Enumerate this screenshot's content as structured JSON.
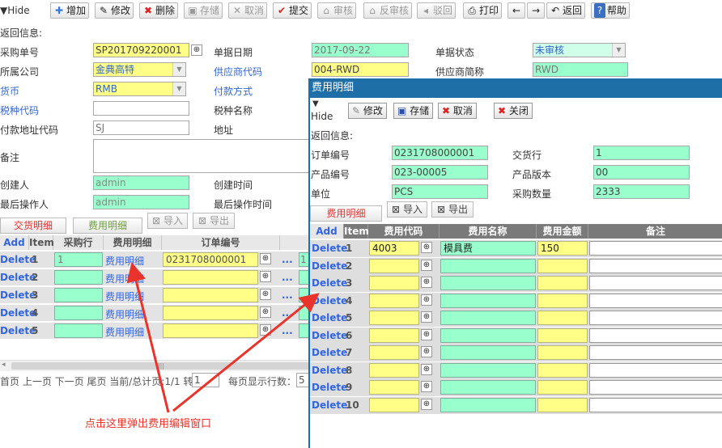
{
  "toolbar": {
    "hide": "Hide",
    "buttons": [
      {
        "label": "增加",
        "icon": "✚"
      },
      {
        "label": "修改",
        "icon": "✎"
      },
      {
        "label": "删除",
        "icon": "✖"
      },
      {
        "label": "存储",
        "icon": "▣"
      },
      {
        "label": "取消",
        "icon": "✕"
      },
      {
        "label": "提交",
        "icon": "✔"
      },
      {
        "label": "审核",
        "icon": "⌂"
      },
      {
        "label": "反审核",
        "icon": "⌂"
      },
      {
        "label": "驳回",
        "icon": "◂"
      },
      {
        "label": "打印",
        "icon": "⎙"
      },
      {
        "label": "返回",
        "icon": "↶"
      },
      {
        "label": "帮助",
        "icon": "?"
      }
    ],
    "prev": "←",
    "next": "→"
  },
  "form": {
    "return_info": "返回信息:",
    "purchase_no_label": "采购单号",
    "purchase_no": "SP201709220001",
    "doc_date_label": "单据日期",
    "doc_date": "2017-09-22",
    "doc_status_label": "单据状态",
    "doc_status": "未审核",
    "company_label": "所属公司",
    "company": "金典高特",
    "supplier_code_label": "供应商代码",
    "supplier_code": "004-RWD",
    "supplier_short_label": "供应商简称",
    "supplier_short": "RWD",
    "currency_label": "货币",
    "currency": "RMB",
    "pay_method_label": "付款方式",
    "tax_code_label": "税种代码",
    "tax_name_label": "税种名称",
    "pay_addr_label": "付款地址代码",
    "pay_addr": "SJ",
    "address_label": "地址",
    "remark_label": "备注",
    "creator_label": "创建人",
    "creator": "admin",
    "create_time_label": "创建时间",
    "last_op_label": "最后操作人",
    "last_op": "admin",
    "last_op_time_label": "最后操作时间"
  },
  "tabs": {
    "delivery": "交货明细",
    "fee": "费用明细",
    "import": "导入",
    "export": "导出"
  },
  "grid": {
    "headers": [
      "Add",
      "Item",
      "采购行",
      "费用明细",
      "订单编号"
    ],
    "rows": [
      {
        "del": "Delete",
        "item": "1",
        "line": "1",
        "fee": "费用明细",
        "order": "0231708000001"
      },
      {
        "del": "Delete",
        "item": "2",
        "line": "",
        "fee": "费用明细",
        "order": ""
      },
      {
        "del": "Delete",
        "item": "3",
        "line": "",
        "fee": "费用明细",
        "order": ""
      },
      {
        "del": "Delete",
        "item": "4",
        "line": "",
        "fee": "费用明细",
        "order": ""
      },
      {
        "del": "Delete",
        "item": "5",
        "line": "",
        "fee": "费用明细",
        "order": ""
      }
    ],
    "ellipsis": "...",
    "extra": "1"
  },
  "pager": {
    "text": "首页 上一页 下一页 尾页 当前/总计页:1/1 转到",
    "goto": "1",
    "per_page_label": "每页显示行数：",
    "per_page": "5",
    "scroll_mark": "|||"
  },
  "annotation": "点击这里弹出费用编辑窗口",
  "popup": {
    "title": "费用明细",
    "hide": "Hide",
    "buttons": {
      "edit": "修改",
      "save": "存储",
      "cancel": "取消",
      "close": "关闭"
    },
    "return_info": "返回信息:",
    "order_no_label": "订单编号",
    "order_no": "0231708000001",
    "delivery_line_label": "交货行",
    "delivery_line": "1",
    "product_no_label": "产品编号",
    "product_no": "023-00005",
    "product_ver_label": "产品版本",
    "product_ver": "00",
    "unit_label": "单位",
    "unit": "PCS",
    "purchase_qty_label": "采购数量",
    "purchase_qty": "2333",
    "tab_fee": "费用明细",
    "import": "导入",
    "export": "导出",
    "headers": [
      "Add",
      "Item",
      "费用代码",
      "费用名称",
      "费用金额",
      "备注"
    ],
    "rows": [
      {
        "del": "Delete",
        "item": "1",
        "code": "4003",
        "name": "模具费",
        "amount": "150"
      },
      {
        "del": "Delete",
        "item": "2",
        "code": "",
        "name": "",
        "amount": ""
      },
      {
        "del": "Delete",
        "item": "3",
        "code": "",
        "name": "",
        "amount": ""
      },
      {
        "del": "Delete",
        "item": "4",
        "code": "",
        "name": "",
        "amount": ""
      },
      {
        "del": "Delete",
        "item": "5",
        "code": "",
        "name": "",
        "amount": ""
      },
      {
        "del": "Delete",
        "item": "6",
        "code": "",
        "name": "",
        "amount": ""
      },
      {
        "del": "Delete",
        "item": "7",
        "code": "",
        "name": "",
        "amount": ""
      },
      {
        "del": "Delete",
        "item": "8",
        "code": "",
        "name": "",
        "amount": ""
      },
      {
        "del": "Delete",
        "item": "9",
        "code": "",
        "name": "",
        "amount": ""
      },
      {
        "del": "Delete",
        "item": "10",
        "code": "",
        "name": "",
        "amount": ""
      }
    ]
  },
  "colors": {
    "arrow": "#e8342c",
    "popup_title": "#1e6fa8",
    "cyan": "#99ffcc",
    "yellow": "#ffff88"
  }
}
